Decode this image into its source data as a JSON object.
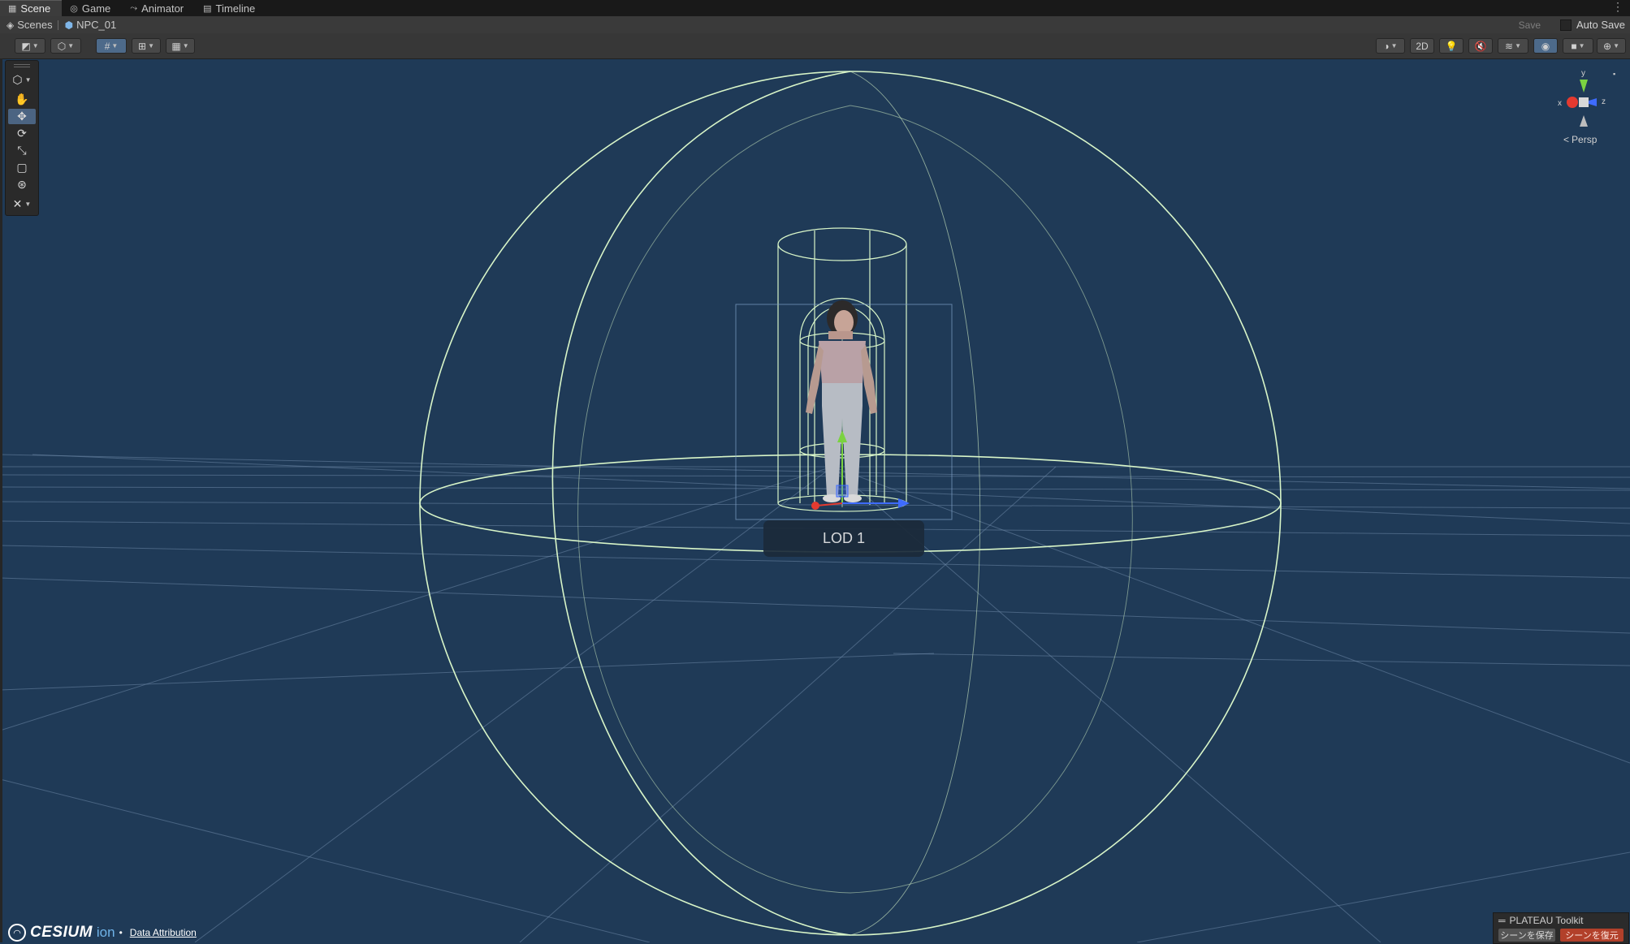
{
  "tabs": [
    {
      "label": "Scene",
      "icon": "grid-icon",
      "active": true
    },
    {
      "label": "Game",
      "icon": "gamepad-icon",
      "active": false
    },
    {
      "label": "Animator",
      "icon": "animator-icon",
      "active": false
    },
    {
      "label": "Timeline",
      "icon": "timeline-icon",
      "active": false
    }
  ],
  "breadcrumb": {
    "scenes": "Scenes",
    "prefab": "NPC_01"
  },
  "header": {
    "save_label": "Save",
    "autosave_label": "Auto Save",
    "autosave_checked": false
  },
  "toolbar": {
    "mode_2d_label": "2D"
  },
  "tools": [
    "view-tool",
    "move-tool",
    "rotate-tool",
    "scale-tool",
    "rect-tool",
    "transform-tool",
    "custom-tool"
  ],
  "orientation_gizmo": {
    "y_label": "y",
    "x_label": "x",
    "z_label": "z",
    "projection_label": "Persp"
  },
  "scene": {
    "lod_label": "LOD 1",
    "grid_color": "#5b7896",
    "bounds_color": "#d8f5c8"
  },
  "cesium": {
    "brand": "CESIUM",
    "suffix": "ion",
    "attribution_label": "Data Attribution"
  },
  "plateau": {
    "title": "PLATEAU Toolkit",
    "save_scene_label": "シーンを保存",
    "restore_scene_label": "シーンを復元"
  }
}
